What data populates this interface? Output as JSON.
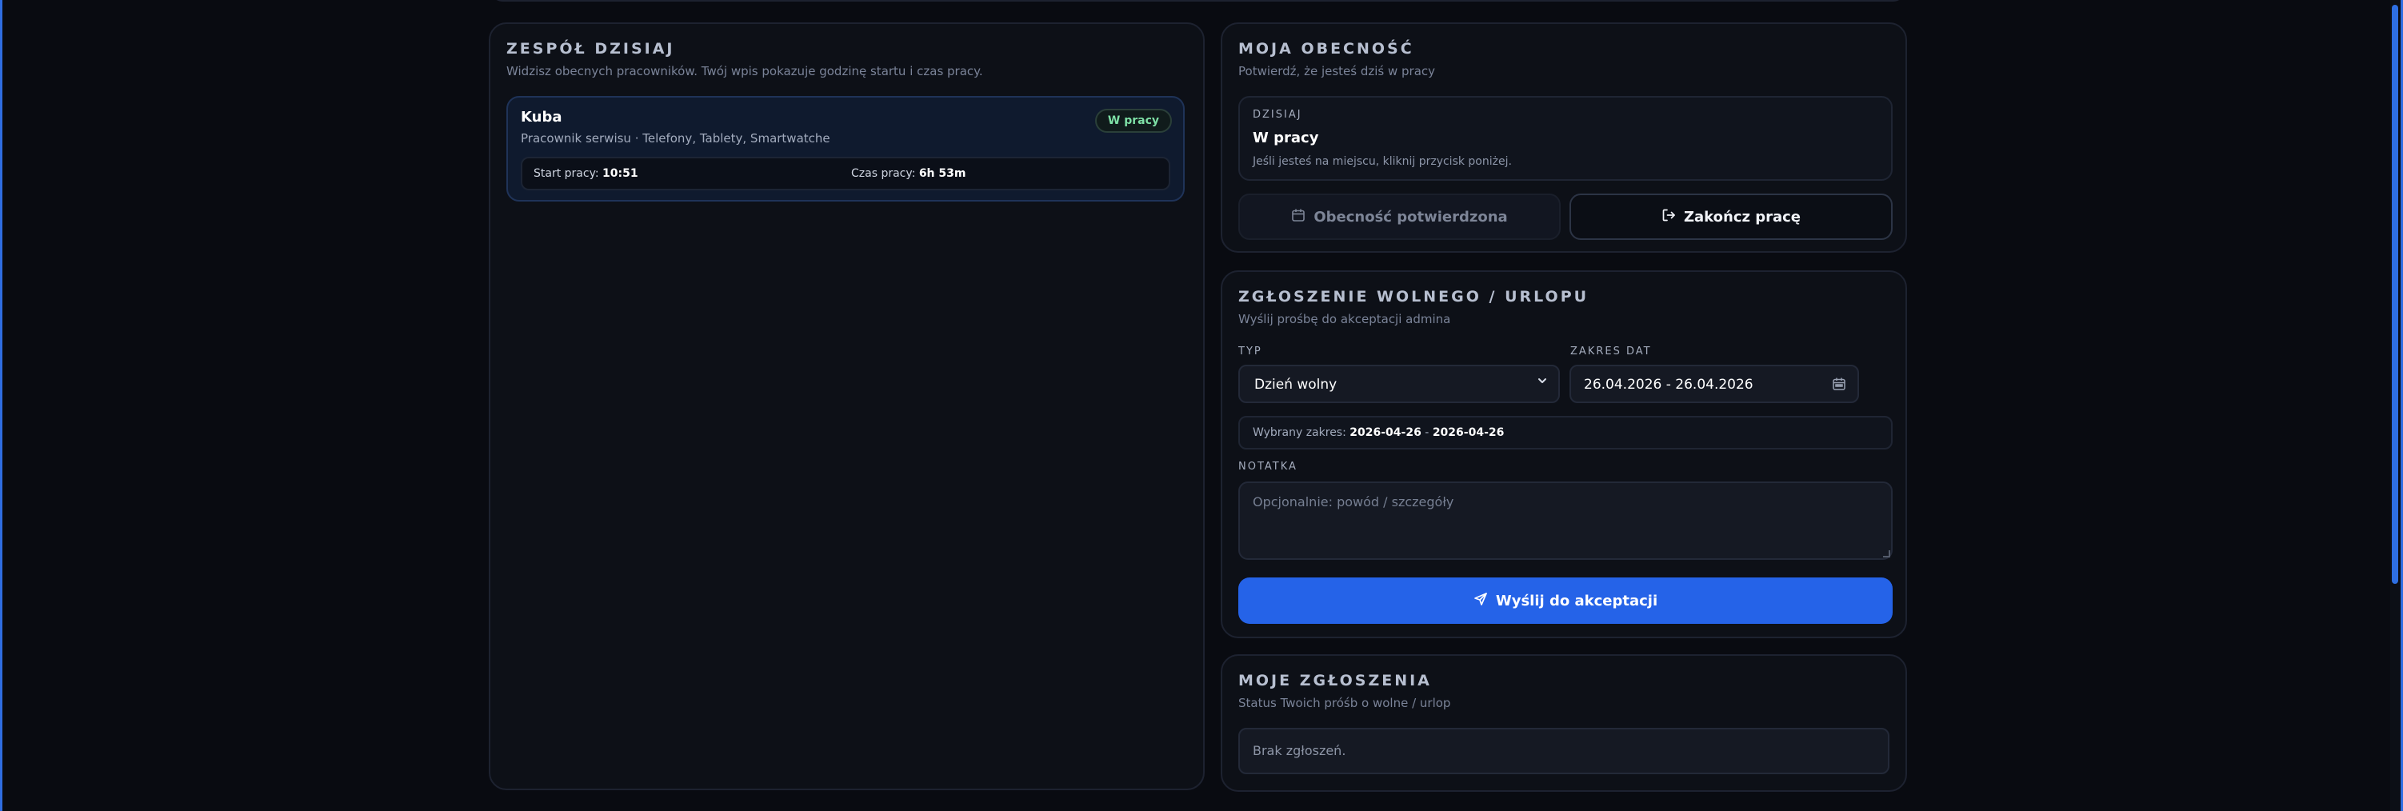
{
  "team": {
    "title": "ZESPÓŁ DZISIAJ",
    "subtitle": "Widzisz obecnych pracowników. Twój wpis pokazuje godzinę startu i czas pracy.",
    "employees": [
      {
        "name": "Kuba",
        "role": "Pracownik serwisu · Telefony, Tablety, Smartwatche",
        "status": "W pracy",
        "start_label": "Start pracy:",
        "start_value": "10:51",
        "time_label": "Czas pracy:",
        "time_value": "6h 53m"
      }
    ]
  },
  "attendance": {
    "title": "MOJA OBECNOŚĆ",
    "subtitle": "Potwierdź, że jesteś dziś w pracy",
    "today_label": "DZISIAJ",
    "today_status": "W pracy",
    "today_hint": "Jeśli jesteś na miejscu, kliknij przycisk poniżej.",
    "confirmed_button": "Obecność potwierdzona",
    "finish_button": "Zakończ pracę"
  },
  "leave": {
    "title": "ZGŁOSZENIE WOLNEGO / URLOPU",
    "subtitle": "Wyślij prośbę do akceptacji admina",
    "type_label": "TYP",
    "type_value": "Dzień wolny",
    "range_label": "ZAKRES DAT",
    "range_value": "26.04.2026 - 26.04.2026",
    "selected_prefix": "Wybrany zakres:",
    "selected_from": "2026-04-26",
    "selected_sep": "-",
    "selected_to": "2026-04-26",
    "note_label": "NOTATKA",
    "note_placeholder": "Opcjonalnie: powód / szczegóły",
    "send_button": "Wyślij do akceptacji"
  },
  "requests": {
    "title": "MOJE ZGŁOSZENIA",
    "subtitle": "Status Twoich próśb o wolne / urlop",
    "empty": "Brak zgłoszeń."
  },
  "colors": {
    "accent": "#2563e8",
    "success": "#7ee0a6",
    "background": "#090b11"
  }
}
